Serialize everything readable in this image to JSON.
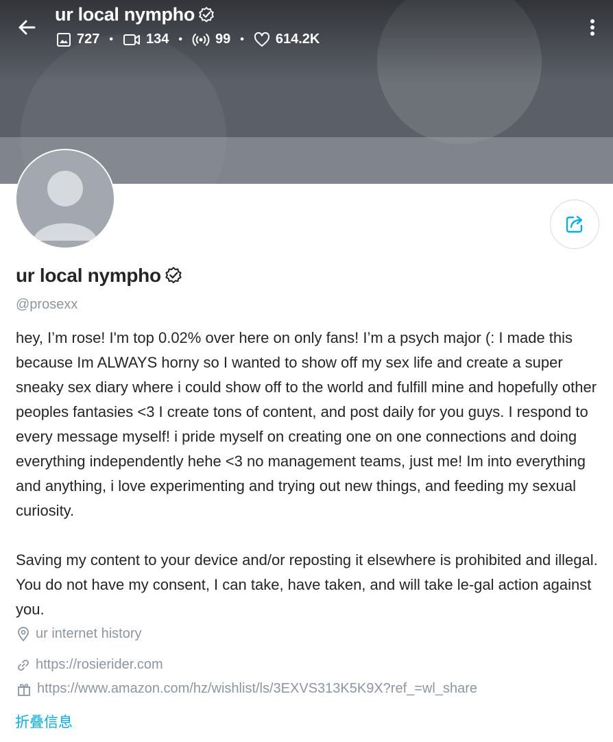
{
  "header": {
    "title": "ur local nympho",
    "stats": {
      "photos": "727",
      "videos": "134",
      "streams": "99",
      "likes": "614.2K"
    }
  },
  "profile": {
    "name": "ur local nympho",
    "handle": "@prosexx",
    "bio": "hey, I’m rose! I'm top 0.02% over here on only fans! I’m a psych major (: I made this because Im ALWAYS horny so I wanted to show off my sex life and create a super sneaky sex diary where i could show off to the world and fulfill mine and hopefully other peoples fantasies <3 I create tons of content, and post daily for you guys. I respond to every message myself! i pride myself on creating one on one connections and doing everything independently hehe <3 no management teams, just me! Im into everything and anything, i love experimenting and trying out new things, and feeding my sexual curiosity.\n\nSaving my content to your device and/or reposting it elsewhere is prohibited and illegal. You do not have my consent, I can take, have taken, and will take le-gal action against you.",
    "location": "ur internet history",
    "website": "https://rosierider.com",
    "wishlist": "https://www.amazon.com/hz/wishlist/ls/3EXVS313K5K9X?ref_=wl_share",
    "collapse_label": "折叠信息"
  },
  "colors": {
    "accent": "#00aff0",
    "muted": "#8a96a3",
    "text": "#242529"
  },
  "icons": [
    "back-arrow-icon",
    "verified-icon",
    "image-icon",
    "video-icon",
    "stream-icon",
    "heart-icon",
    "more-vertical-icon",
    "share-icon",
    "location-icon",
    "link-icon",
    "gift-icon"
  ]
}
